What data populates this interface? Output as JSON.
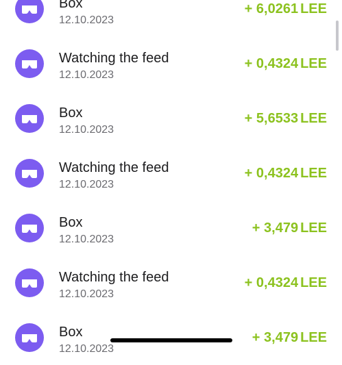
{
  "colors": {
    "accent": "#7c5cf0",
    "amount": "#8cc21f",
    "title": "#1c1c1e",
    "date": "#6b6b70"
  },
  "transactions": [
    {
      "title": "Box",
      "date": "12.10.2023",
      "amount": "+ 6,0261",
      "currency": "LEE",
      "icon": "vr-goggles-icon"
    },
    {
      "title": "Watching the feed",
      "date": "12.10.2023",
      "amount": "+ 0,4324",
      "currency": "LEE",
      "icon": "vr-goggles-icon"
    },
    {
      "title": "Box",
      "date": "12.10.2023",
      "amount": "+ 5,6533",
      "currency": "LEE",
      "icon": "vr-goggles-icon"
    },
    {
      "title": "Watching the feed",
      "date": "12.10.2023",
      "amount": "+ 0,4324",
      "currency": "LEE",
      "icon": "vr-goggles-icon"
    },
    {
      "title": "Box",
      "date": "12.10.2023",
      "amount": "+ 3,479",
      "currency": "LEE",
      "icon": "vr-goggles-icon"
    },
    {
      "title": "Watching the feed",
      "date": "12.10.2023",
      "amount": "+ 0,4324",
      "currency": "LEE",
      "icon": "vr-goggles-icon"
    },
    {
      "title": "Box",
      "date": "12.10.2023",
      "amount": "+ 3,479",
      "currency": "LEE",
      "icon": "vr-goggles-icon"
    }
  ]
}
